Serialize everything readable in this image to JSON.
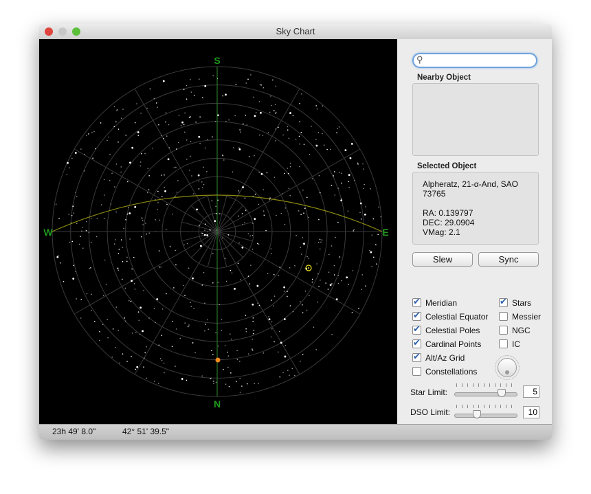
{
  "window": {
    "title": "Sky Chart"
  },
  "chart": {
    "cardinal": {
      "north": "N",
      "south": "S",
      "east": "E",
      "west": "W"
    },
    "alt_rings_deg": 10,
    "colors": {
      "grid": "#3a3a3a",
      "meridian": "#2e8b2e",
      "equator": "#8a8a10",
      "cardinal": "#1f9a1f",
      "star": "#ffffff",
      "selected": "#e8e020",
      "pole": "#ff8c1a"
    }
  },
  "sidebar": {
    "search": {
      "placeholder": "",
      "value": ""
    },
    "nearby": {
      "label": "Nearby Object",
      "text": ""
    },
    "selected": {
      "label": "Selected Object",
      "name": "Alpheratz, 21-α-And, SAO 73765",
      "ra": "RA: 0.139797",
      "dec": "DEC: 29.0904",
      "vmag": "VMag: 2.1"
    },
    "buttons": {
      "slew": "Slew",
      "sync": "Sync"
    },
    "options": [
      {
        "label": "Meridian",
        "checked": true
      },
      {
        "label": "Celestial Equator",
        "checked": true
      },
      {
        "label": "Celestial Poles",
        "checked": true
      },
      {
        "label": "Cardinal Points",
        "checked": true
      },
      {
        "label": "Alt/Az Grid",
        "checked": true
      },
      {
        "label": "Constellations",
        "checked": false
      },
      {
        "label": "Stars",
        "checked": true
      },
      {
        "label": "Messier",
        "checked": false
      },
      {
        "label": "NGC",
        "checked": false
      },
      {
        "label": "IC",
        "checked": false
      }
    ],
    "star_limit": {
      "label": "Star Limit:",
      "value": "5",
      "fraction": 0.77
    },
    "dso_limit": {
      "label": "DSO Limit:",
      "value": "10",
      "fraction": 0.33
    }
  },
  "status": {
    "ra": "23h 49' 8.0\"",
    "dec": "42° 51' 39.5\""
  }
}
